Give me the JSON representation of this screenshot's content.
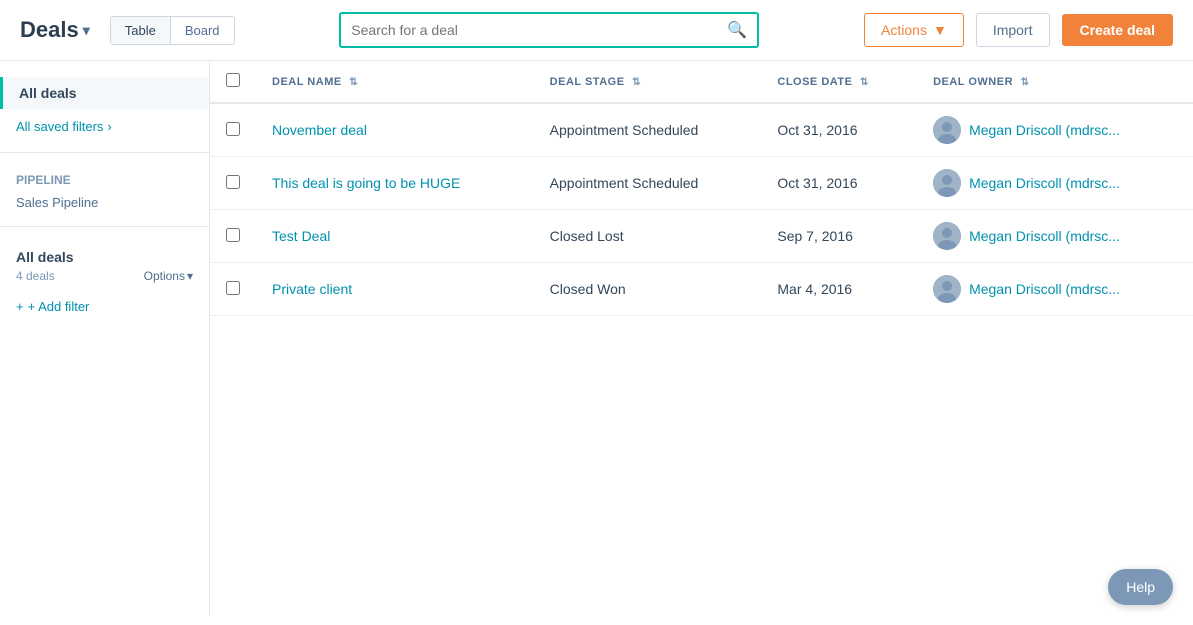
{
  "header": {
    "title": "Deals",
    "chevron": "▾",
    "views": [
      {
        "id": "table",
        "label": "Table",
        "active": true
      },
      {
        "id": "board",
        "label": "Board",
        "active": false
      }
    ],
    "search_placeholder": "Search for a deal",
    "actions_label": "Actions",
    "import_label": "Import",
    "create_label": "Create deal"
  },
  "sidebar": {
    "all_deals_label": "All deals",
    "saved_filters_label": "All saved filters",
    "pipeline_label": "Pipeline",
    "pipeline_value": "Sales Pipeline",
    "all_deals_section_label": "All deals",
    "deals_count": "4 deals",
    "options_label": "Options",
    "add_filter_label": "+ Add filter"
  },
  "table": {
    "columns": [
      {
        "id": "deal-name",
        "label": "DEAL NAME",
        "sort": true
      },
      {
        "id": "deal-stage",
        "label": "DEAL STAGE",
        "sort": true
      },
      {
        "id": "close-date",
        "label": "CLOSE DATE",
        "sort": true,
        "active": true
      },
      {
        "id": "deal-owner",
        "label": "DEAL OWNER",
        "sort": true
      }
    ],
    "rows": [
      {
        "id": 1,
        "name": "November deal",
        "stage": "Appointment Scheduled",
        "close_date": "Oct 31, 2016",
        "owner": "Megan Driscoll (mdrsc..."
      },
      {
        "id": 2,
        "name": "This deal is going to be HUGE",
        "stage": "Appointment Scheduled",
        "close_date": "Oct 31, 2016",
        "owner": "Megan Driscoll (mdrsc..."
      },
      {
        "id": 3,
        "name": "Test Deal",
        "stage": "Closed Lost",
        "close_date": "Sep 7, 2016",
        "owner": "Megan Driscoll (mdrsc..."
      },
      {
        "id": 4,
        "name": "Private client",
        "stage": "Closed Won",
        "close_date": "Mar 4, 2016",
        "owner": "Megan Driscoll (mdrsc..."
      }
    ]
  },
  "help_label": "Help",
  "colors": {
    "accent": "#00bda5",
    "orange": "#f0823a",
    "link": "#0091ae"
  }
}
